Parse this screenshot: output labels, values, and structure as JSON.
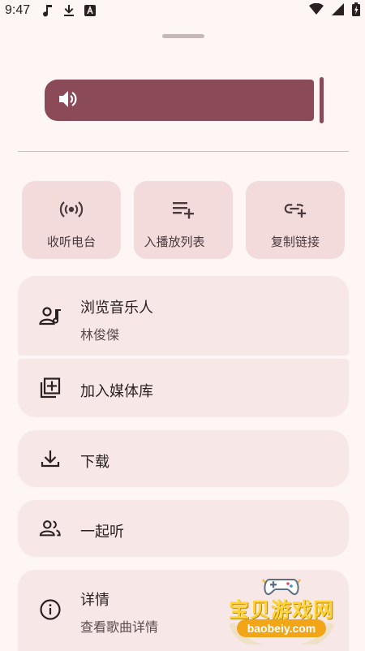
{
  "status_bar": {
    "time": "9:47",
    "left_icons": [
      "music-note-icon",
      "download-icon",
      "app-notification-icon"
    ],
    "right_icons": [
      "wifi-icon",
      "signal-icon",
      "battery-charging-icon"
    ]
  },
  "volume": {
    "icon": "volume-icon",
    "level": 0.87,
    "color": "#8a4a57"
  },
  "quick_actions": [
    {
      "icon": "radio-icon",
      "label": "收听电台"
    },
    {
      "icon": "playlist-add-icon",
      "label": "入播放列表"
    },
    {
      "icon": "link-add-icon",
      "label": "复制链接"
    }
  ],
  "menu": {
    "browse_artist": {
      "title": "浏览音乐人",
      "subtitle": "林俊傑",
      "icon": "artist-icon"
    },
    "add_library": {
      "title": "加入媒体库",
      "icon": "library-add-icon"
    },
    "download": {
      "title": "下载",
      "icon": "download-icon"
    },
    "listen_together": {
      "title": "一起听",
      "icon": "people-icon"
    },
    "details": {
      "title": "详情",
      "subtitle": "查看歌曲详情",
      "icon": "info-icon"
    }
  },
  "watermark": {
    "title": "宝贝游戏网",
    "url": "baobeiy.com"
  },
  "colors": {
    "background": "#fdf6f5",
    "card": "#f7e7e7",
    "quick_action": "#f3dbdc",
    "accent": "#8a4a57"
  }
}
